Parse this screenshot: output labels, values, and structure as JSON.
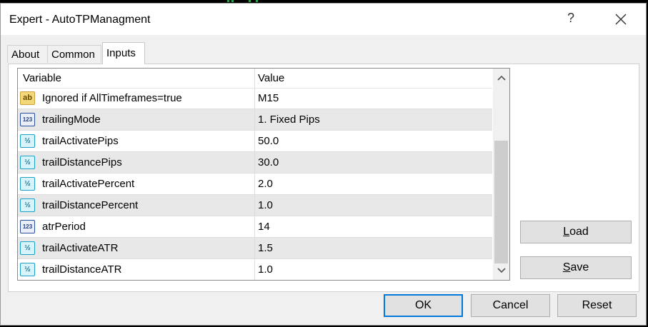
{
  "window": {
    "title": "Expert - AutoTPManagment",
    "help_glyph": "?"
  },
  "tabs": [
    {
      "label": "About",
      "active": false
    },
    {
      "label": "Common",
      "active": false
    },
    {
      "label": "Inputs",
      "active": true
    }
  ],
  "grid": {
    "columns": {
      "variable": "Variable",
      "value": "Value"
    },
    "rows": [
      {
        "icon": "string-icon",
        "variable": "Ignored if AllTimeframes=true",
        "value": "M15"
      },
      {
        "icon": "integer-icon",
        "variable": "trailingMode",
        "value": "1. Fixed Pips"
      },
      {
        "icon": "double-icon",
        "variable": "trailActivatePips",
        "value": "50.0"
      },
      {
        "icon": "double-icon",
        "variable": "trailDistancePips",
        "value": "30.0"
      },
      {
        "icon": "double-icon",
        "variable": "trailActivatePercent",
        "value": "2.0"
      },
      {
        "icon": "double-icon",
        "variable": "trailDistancePercent",
        "value": "1.0"
      },
      {
        "icon": "integer-icon",
        "variable": "atrPeriod",
        "value": "14"
      },
      {
        "icon": "double-icon",
        "variable": "trailActivateATR",
        "value": "1.5"
      },
      {
        "icon": "double-icon",
        "variable": "trailDistanceATR",
        "value": "1.0"
      }
    ],
    "icon_glyphs": {
      "string": "ab",
      "integer": "123",
      "double": "½"
    }
  },
  "buttons": {
    "load_prefix": "",
    "load_accel": "L",
    "load_rest": "oad",
    "save_accel": "S",
    "save_rest": "ave",
    "ok": "OK",
    "cancel": "Cancel",
    "reset": "Reset"
  }
}
